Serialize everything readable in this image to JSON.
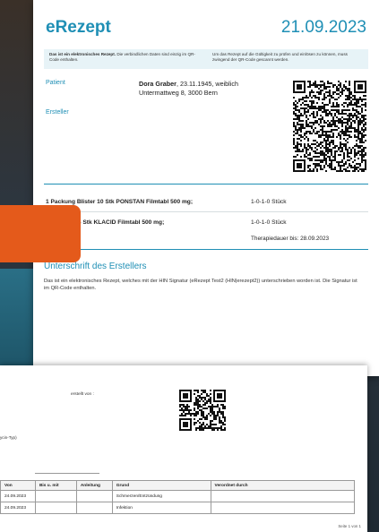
{
  "prescription": {
    "title": "eRezept",
    "date": "21.09.2023",
    "info_left_bold": "Das ist ein elektronisches Rezept.",
    "info_left_rest": " Die verbindlichen Daten sind einzig im QR-Code enthalten.",
    "info_right": "Um das Rezept auf die Gültigkeit zu prüfen und einlösen zu können, muss zwingend der QR-Code gescannt werden.",
    "patient_label": "Patient",
    "issuer_label": "Ersteller",
    "patient_name": "Dora Graber",
    "patient_details": ", 23.11.1945, weiblich",
    "patient_address": "Untermattweg 8, 3000 Bern",
    "medications": [
      {
        "name": "1 Packung Blister 10 Stk PONSTAN Filmtabl 500 mg;",
        "dose": "1-0-1-0 Stück"
      },
      {
        "name": "ng Blister 14 Stk KLACID Filmtabl 500 mg;",
        "dose": "1-0-1-0 Stück"
      }
    ],
    "therapy": "Therapiedauer bis: 28.09.2023",
    "signature_title": "Unterschrift des Erstellers",
    "signature_text": "Das ist ein elektronisches Rezept, welches mit der HIN Signatur (eRezept Test2 (HIN|erezept2)) unterschrieben worden ist. Die Signatur ist im QR-Code enthalten."
  },
  "plan": {
    "created_by": "erstellt von :",
    "partial_text": "ycin-Typ)",
    "columns": [
      "Von",
      "Bis u. mit",
      "Anleitung",
      "Grund",
      "Verordnet durch"
    ],
    "rows": [
      {
        "from": "24.09.2023",
        "until": "",
        "instruction": "",
        "reason": "Schmerzen/Entzündung",
        "prescribed_by": ""
      },
      {
        "from": "24.09.2023",
        "until": "",
        "instruction": "",
        "reason": "Infektion",
        "prescribed_by": ""
      }
    ],
    "page_label": "Seite 1 von 1"
  }
}
